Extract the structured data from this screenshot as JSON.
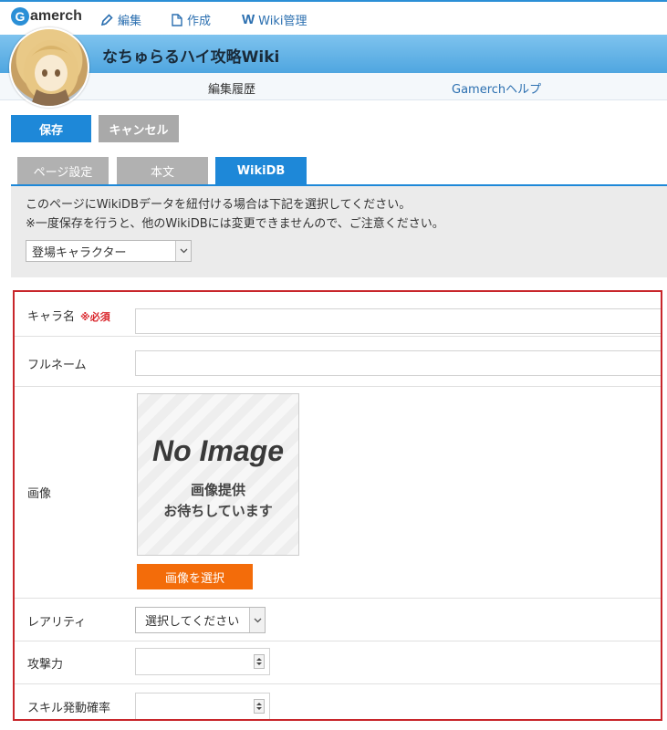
{
  "topbar": {
    "logo_text": "amerch",
    "logo_letter": "G",
    "edit": "編集",
    "create": "作成",
    "wiki_admin_letter": "W",
    "wiki_admin": "Wiki管理"
  },
  "site": {
    "title": "なちゅらるハイ攻略Wiki",
    "nav_history": "編集履歴",
    "nav_help": "Gamerchヘルプ"
  },
  "toolbar": {
    "save": "保存",
    "cancel": "キャンセル"
  },
  "tabs": [
    {
      "label": "ページ設定",
      "active": false
    },
    {
      "label": "本文",
      "active": false
    },
    {
      "label": "WikiDB",
      "active": true
    }
  ],
  "wikidb": {
    "note1": "このページにWikiDBデータを紐付ける場合は下記を選択してください。",
    "note2": "※一度保存を行うと、他のWikiDBには変更できませんので、ご注意ください。",
    "selected": "登場キャラクター"
  },
  "form": {
    "name_label": "キャラ名",
    "required": "※必須",
    "fullname_label": "フルネーム",
    "image_label": "画像",
    "noimage_title": "No Image",
    "noimage_line1": "画像提供",
    "noimage_line2": "お待ちしています",
    "select_image": "画像を選択",
    "rarity_label": "レアリティ",
    "rarity_selected": "選択してください",
    "attack_label": "攻撃力",
    "skill_label": "スキル発動確率"
  },
  "colors": {
    "primary": "#1e88d8",
    "highlight_border": "#c8262b",
    "orange": "#f36c0a"
  }
}
